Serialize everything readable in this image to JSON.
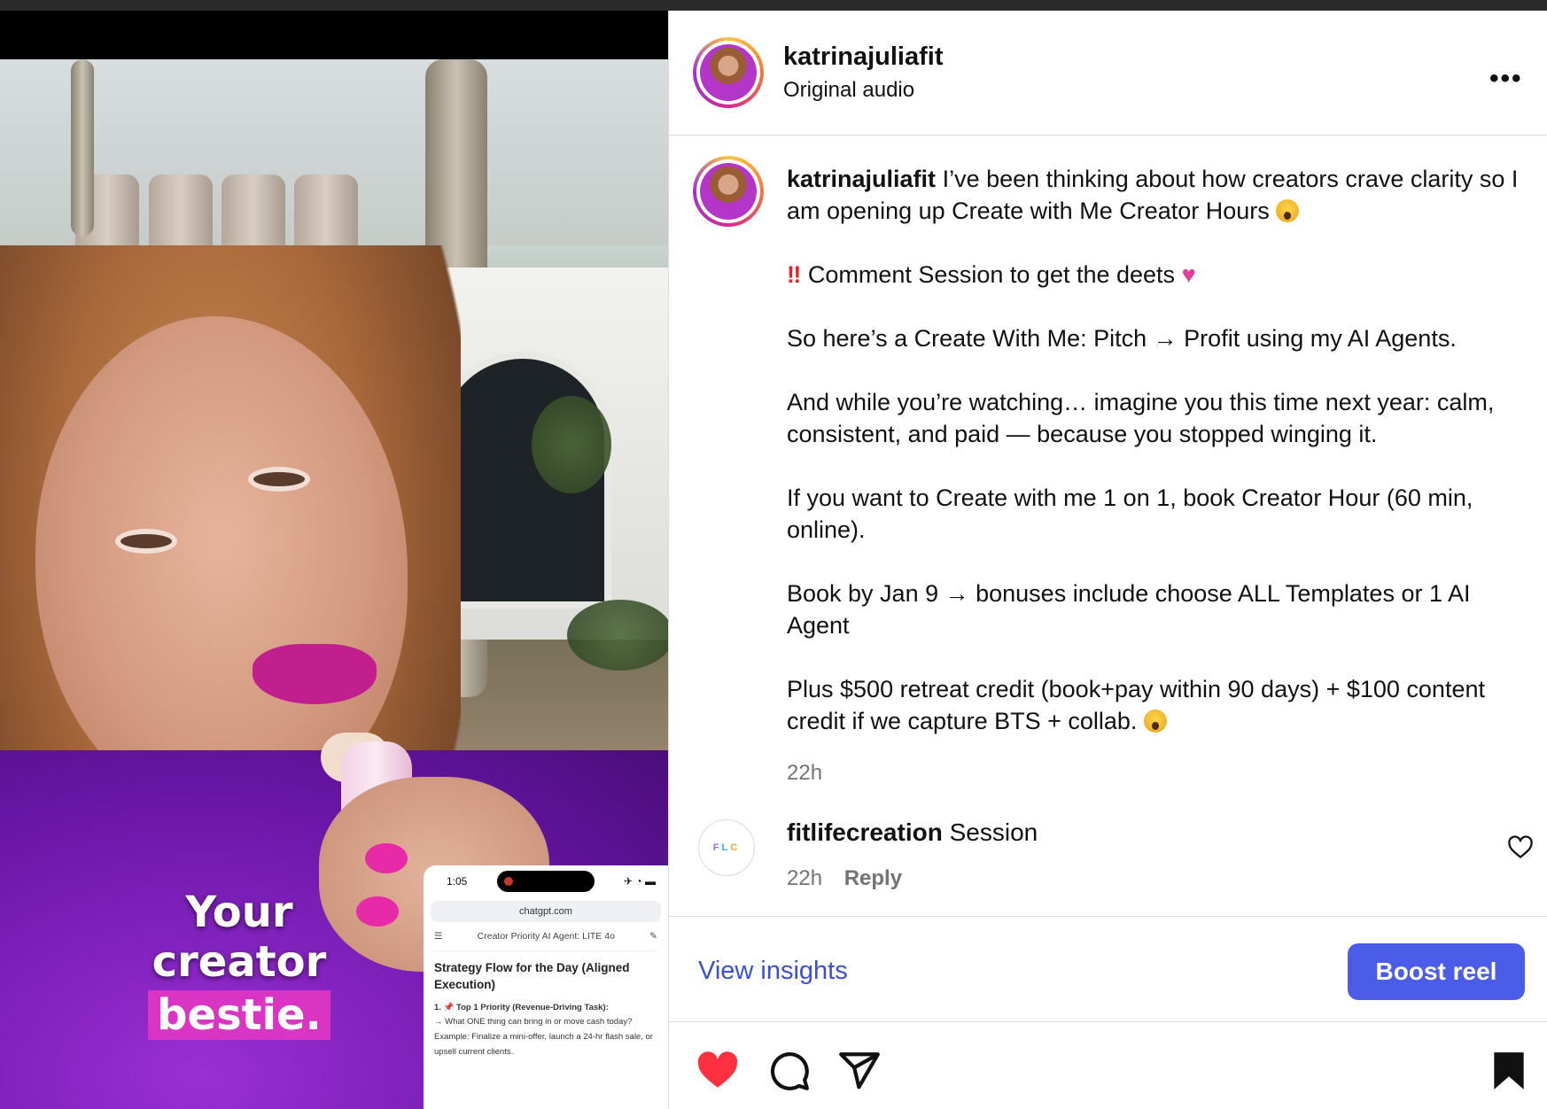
{
  "post": {
    "username": "katrinajuliafit",
    "audio": "Original audio",
    "more_label": "•••"
  },
  "video": {
    "caption_line1": "Your creator",
    "caption_line2": "bestie.",
    "phone": {
      "time": "1:05",
      "url": "chatgpt.com",
      "agent": "Creator Priority AI Agent: LITE 4o",
      "strategy_title": "Strategy Flow for the Day (Aligned Execution)",
      "step_title": "Top 1 Priority (Revenue-Driving Task):",
      "step_q": "→ What ONE thing can bring in or move cash today?",
      "step_example": "Example: Finalize a mini-offer, launch a 24-hr flash sale, or upsell current clients."
    }
  },
  "caption": {
    "username": "katrinajuliafit",
    "p1": "I’ve been thinking about how creators crave clarity so I am opening up Create with Me Creator Hours",
    "p2": "Comment Session to get the deets",
    "p3": "So here’s a Create With Me: Pitch → Profit using my AI Agents.",
    "p4": "And while you’re watching… imagine you this time next year: calm, consistent, and paid — because you stopped winging it.",
    "p5": "If you want to Create with me 1 on 1, book Creator Hour (60 min, online).",
    "p6": "Book by Jan 9 → bonuses include choose ALL Templates or 1 AI Agent",
    "p7": "Plus $500 retreat credit (book+pay within 90 days) + $100 content credit if we capture BTS + collab.",
    "time": "22h"
  },
  "comment": {
    "avatar_text": [
      "F",
      "L",
      "C"
    ],
    "username": "fitlifecreation",
    "text": "Session",
    "time": "22h",
    "reply_label": "Reply"
  },
  "footer": {
    "insights_label": "View insights",
    "boost_label": "Boost reel"
  },
  "colors": {
    "accent_blue": "#4a5ce8",
    "link_blue": "#3b4fd1",
    "like_red": "#ff3040"
  },
  "icons": [
    "like-heart-icon",
    "comment-icon",
    "share-icon",
    "save-bookmark-icon",
    "comment-like-icon",
    "more-options-icon"
  ]
}
